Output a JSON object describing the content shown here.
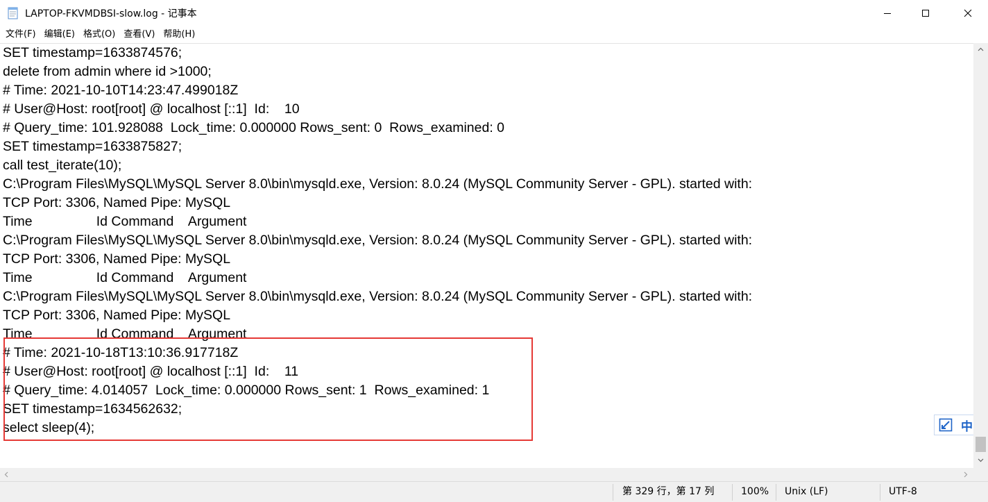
{
  "window": {
    "title": "LAPTOP-FKVMDBSI-slow.log - 记事本"
  },
  "menu": [
    {
      "label": "文件(F)"
    },
    {
      "label": "编辑(E)"
    },
    {
      "label": "格式(O)"
    },
    {
      "label": "查看(V)"
    },
    {
      "label": "帮助(H)"
    }
  ],
  "editor": {
    "lines": [
      "SET timestamp=1633874576;",
      "delete from admin where id >1000;",
      "# Time: 2021-10-10T14:23:47.499018Z",
      "# User@Host: root[root] @ localhost [::1]  Id:    10",
      "# Query_time: 101.928088  Lock_time: 0.000000 Rows_sent: 0  Rows_examined: 0",
      "SET timestamp=1633875827;",
      "call test_iterate(10);",
      "C:\\Program Files\\MySQL\\MySQL Server 8.0\\bin\\mysqld.exe, Version: 8.0.24 (MySQL Community Server - GPL). started with:",
      "TCP Port: 3306, Named Pipe: MySQL",
      "Time                 Id Command    Argument",
      "C:\\Program Files\\MySQL\\MySQL Server 8.0\\bin\\mysqld.exe, Version: 8.0.24 (MySQL Community Server - GPL). started with:",
      "TCP Port: 3306, Named Pipe: MySQL",
      "Time                 Id Command    Argument",
      "C:\\Program Files\\MySQL\\MySQL Server 8.0\\bin\\mysqld.exe, Version: 8.0.24 (MySQL Community Server - GPL). started with:",
      "TCP Port: 3306, Named Pipe: MySQL",
      "Time                 Id Command    Argument",
      "# Time: 2021-10-18T13:10:36.917718Z",
      "# User@Host: root[root] @ localhost [::1]  Id:    11",
      "# Query_time: 4.014057  Lock_time: 0.000000 Rows_sent: 1  Rows_examined: 1",
      "SET timestamp=1634562632;",
      "select sleep(4);"
    ],
    "highlight_color": "#e53935"
  },
  "ime": {
    "mode_icon": "ime-mode-icon",
    "language": "中"
  },
  "status": {
    "position": "第 329 行，第 17 列",
    "zoom": "100%",
    "line_ending": "Unix (LF)",
    "encoding": "UTF-8"
  },
  "colors": {
    "ime_accent": "#1e64c8",
    "statusbar_bg": "#f0f0f0"
  }
}
